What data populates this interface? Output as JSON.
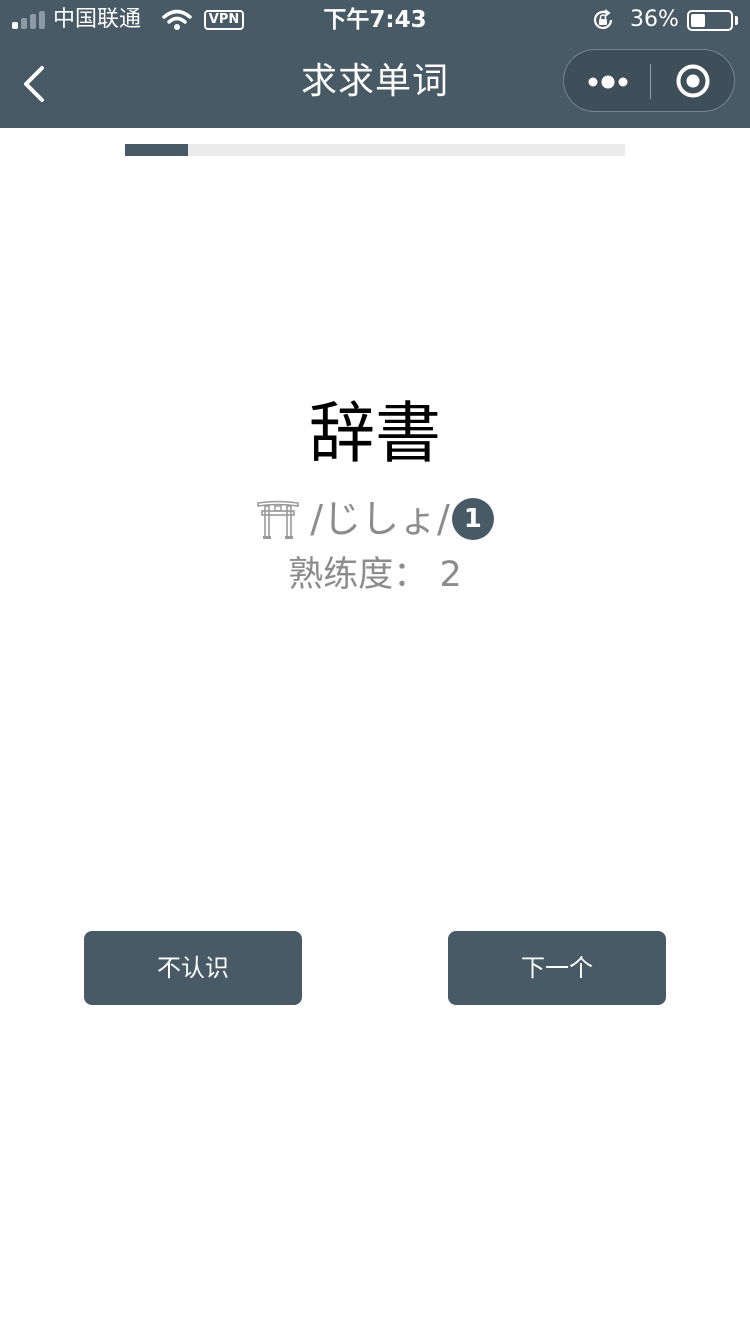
{
  "status_bar": {
    "carrier": "中国联通",
    "vpn": "VPN",
    "time": "下午7:43",
    "battery_percent": "36%",
    "battery_level": 0.36,
    "signal_bars_filled": 1,
    "signal_bars_total": 4
  },
  "nav": {
    "title": "求求单词"
  },
  "progress": {
    "fraction": 0.126
  },
  "card": {
    "word": "辞書",
    "reading": "/じしょ/",
    "pitch_accent": "1",
    "proficiency_label": "熟练度：",
    "proficiency_value": "2"
  },
  "actions": {
    "unknown_label": "不认识",
    "next_label": "下一个"
  },
  "colors": {
    "header": "#485a66",
    "accent": "#485a66",
    "muted_text": "#8c8c8c",
    "progress_track": "#ebebeb"
  },
  "icons": {
    "back": "chevron-left-icon",
    "more": "more-dots-icon",
    "close": "target-circle-icon",
    "reading": "torii-gate-icon",
    "rotation_lock": "rotation-lock-icon"
  }
}
